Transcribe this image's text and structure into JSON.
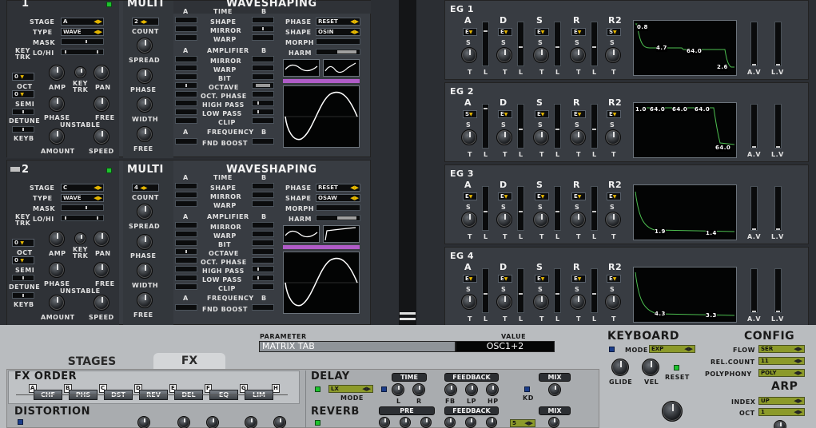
{
  "osc1": {
    "num": "1",
    "multi": "MULTI",
    "waveshaping": "WAVESHAPING",
    "stage": "STAGE",
    "stage_val": "A",
    "type": "TYPE",
    "type_val": "WAVE",
    "mask": "MASK",
    "keytrk_a": "KEY",
    "keytrk_b": "TRK",
    "lohi": "LO/HI",
    "oct": "OCT",
    "oct_val": "0",
    "semi": "SEMI",
    "semi_val": "0",
    "detune": "DETUNE",
    "keyb": "KEYB",
    "amp": "AMP",
    "key": "KEY",
    "trk": "TRK",
    "pan": "PAN",
    "phase": "PHASE",
    "free": "FREE",
    "unstable": "UNSTABLE",
    "amount": "AMOUNT",
    "speed": "SPEED",
    "count": "COUNT",
    "count_val": "2",
    "spread": "SPREAD",
    "phase2": "PHASE",
    "width": "WIDTH",
    "free2": "FREE",
    "a": "A",
    "time": "TIME",
    "b": "B",
    "shape": "SHAPE",
    "mirror": "MIRROR",
    "warp": "WARP",
    "amplifier": "AMPLIFIER",
    "mirror2": "MIRROR",
    "warp2": "WARP",
    "bit": "BIT",
    "octave": "OCTAVE",
    "octphase": "OCT. PHASE",
    "highpass": "HIGH PASS",
    "lowpass": "LOW PASS",
    "clip": "CLIP",
    "frequency": "FREQUENCY",
    "fndboost": "FND BOOST",
    "phase_l": "PHASE",
    "phase_val": "RESET",
    "shape_l": "SHAPE",
    "shape_val": "OSIN",
    "morph": "MORPH",
    "harm": "HARM"
  },
  "osc2": {
    "num": "2",
    "multi": "MULTI",
    "waveshaping": "WAVESHAPING",
    "stage": "STAGE",
    "stage_val": "C",
    "type": "TYPE",
    "type_val": "WAVE",
    "mask": "MASK",
    "keytrk_a": "KEY",
    "keytrk_b": "TRK",
    "lohi": "LO/HI",
    "oct": "OCT",
    "oct_val": "0",
    "semi": "SEMI",
    "semi_val": "0",
    "detune": "DETUNE",
    "keyb": "KEYB",
    "amp": "AMP",
    "key": "KEY",
    "trk": "TRK",
    "pan": "PAN",
    "phase": "PHASE",
    "free": "FREE",
    "unstable": "UNSTABLE",
    "amount": "AMOUNT",
    "speed": "SPEED",
    "count": "COUNT",
    "count_val": "4",
    "spread": "SPREAD",
    "phase2": "PHASE",
    "width": "WIDTH",
    "free2": "FREE",
    "a": "A",
    "time": "TIME",
    "b": "B",
    "shape": "SHAPE",
    "mirror": "MIRROR",
    "warp": "WARP",
    "amplifier": "AMPLIFIER",
    "mirror2": "MIRROR",
    "warp2": "WARP",
    "bit": "BIT",
    "octave": "OCTAVE",
    "octphase": "OCT. PHASE",
    "highpass": "HIGH PASS",
    "lowpass": "LOW PASS",
    "clip": "CLIP",
    "frequency": "FREQUENCY",
    "fndboost": "FND BOOST",
    "phase_l": "PHASE",
    "phase_val": "RESET",
    "shape_l": "SHAPE",
    "shape_val": "OSAW",
    "morph": "MORPH",
    "harm": "HARM"
  },
  "eg": [
    {
      "title": "EG 1",
      "cols": [
        "A",
        "D",
        "S",
        "R",
        "R2"
      ],
      "sel": [
        "E",
        "E",
        "E",
        "E",
        "S"
      ],
      "tl": [
        "T",
        "L",
        "T",
        "L",
        "T",
        "L",
        "T",
        "L",
        "T"
      ],
      "s": "S",
      "labels": [
        "0.8",
        "4.7",
        "64.0",
        "2.6"
      ],
      "av": "A.V",
      "lv": "L.V"
    },
    {
      "title": "EG 2",
      "cols": [
        "A",
        "D",
        "S",
        "R",
        "R2"
      ],
      "sel": [
        "S",
        "E",
        "E",
        "E",
        "E"
      ],
      "tl": [
        "T",
        "L",
        "T",
        "L",
        "T",
        "L",
        "T",
        "L",
        "T"
      ],
      "s": "S",
      "labels": [
        "1.0",
        "64.0",
        "64.0",
        "64.0",
        "64.0"
      ],
      "av": "A.V",
      "lv": "L.V"
    },
    {
      "title": "EG 3",
      "cols": [
        "A",
        "D",
        "S",
        "R",
        "R2"
      ],
      "sel": [
        "E",
        "E",
        "E",
        "E",
        "E"
      ],
      "tl": [
        "T",
        "L",
        "T",
        "L",
        "T",
        "L",
        "T",
        "L",
        "T"
      ],
      "s": "S",
      "labels": [
        "1.9",
        "1.4"
      ],
      "av": "A.V",
      "lv": "L.V"
    },
    {
      "title": "EG 4",
      "cols": [
        "A",
        "D",
        "S",
        "R",
        "R2"
      ],
      "sel": [
        "E",
        "E",
        "E",
        "E",
        "E"
      ],
      "tl": [
        "T",
        "L",
        "T",
        "L",
        "T",
        "L",
        "T",
        "L",
        "T"
      ],
      "s": "S",
      "labels": [
        "4.3",
        "3.3"
      ],
      "av": "A.V",
      "lv": "L.V"
    }
  ],
  "param": {
    "parameter": "PARAMETER",
    "value": "VALUE",
    "param_val": "MATRIX TAB",
    "value_val": "OSC1+2"
  },
  "tabs": {
    "stages": "STAGES",
    "fx": "FX"
  },
  "fxorder": {
    "title": "FX ORDER",
    "letters": [
      "A",
      "B",
      "C",
      "D",
      "E",
      "F",
      "G",
      "H"
    ],
    "items": [
      "CHF",
      "PHS",
      "DST",
      "REV",
      "DEL",
      "EQ",
      "LIM"
    ]
  },
  "distortion": "DISTORTION",
  "delay": {
    "title": "DELAY",
    "mode_val": "LX",
    "mode": "MODE",
    "time": "TIME",
    "l": "L",
    "r": "R",
    "feedback": "FEEDBACK",
    "fb": "FB",
    "lp": "LP",
    "hp": "HP",
    "mix": "MIX",
    "kd": "KD"
  },
  "reverb": {
    "title": "REVERB",
    "pre": "PRE",
    "feedback": "FEEDBACK",
    "mix": "MIX",
    "val": "5"
  },
  "keyboard": {
    "title": "KEYBOARD",
    "mode": "MODE",
    "mode_val": "EXP",
    "glide": "GLIDE",
    "vel": "VEL",
    "reset": "RESET"
  },
  "config": {
    "title": "CONFIG",
    "flow": "FLOW",
    "flow_val": "SER",
    "relcount": "REL.COUNT",
    "relcount_val": "11",
    "polyphony": "POLYPHONY",
    "polyphony_val": "POLY"
  },
  "arp": {
    "title": "ARP",
    "index": "INDEX",
    "index_val": "UP",
    "oct": "OCT",
    "oct_val": "1"
  }
}
